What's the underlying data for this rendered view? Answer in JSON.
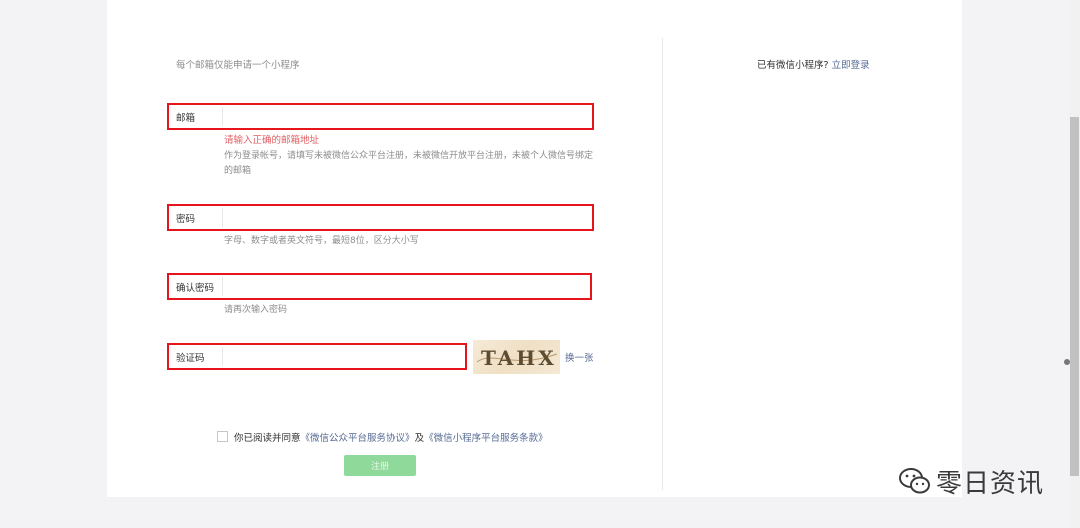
{
  "page": {
    "note": "每个邮箱仅能申请一个小程序",
    "login_prompt": "已有微信小程序?",
    "login_link": "立即登录"
  },
  "form": {
    "email": {
      "label": "邮箱",
      "value": "",
      "error": "请输入正确的邮箱地址",
      "hint": "作为登录帐号，请填写未被微信公众平台注册，未被微信开放平台注册，未被个人微信号绑定的邮箱"
    },
    "password": {
      "label": "密码",
      "value": "",
      "hint": "字母、数字或者英文符号，最短8位，区分大小写"
    },
    "confirm_password": {
      "label": "确认密码",
      "value": "",
      "hint": "请再次输入密码"
    },
    "captcha": {
      "label": "验证码",
      "value": "",
      "image_text": "TAHX",
      "refresh_label": "换一张"
    }
  },
  "agreement": {
    "checked": false,
    "prefix": "你已阅读并同意",
    "link1": "《微信公众平台服务协议》",
    "and": "及",
    "link2": "《微信小程序平台服务条款》"
  },
  "submit_label": "注册",
  "watermark": {
    "text": "零日资讯",
    "icon": "wechat-bubble-icon"
  },
  "colors": {
    "highlight_border": "#e8141b",
    "error_text": "#e15f63",
    "link": "#576b95",
    "submit_bg": "#8fd99b"
  }
}
